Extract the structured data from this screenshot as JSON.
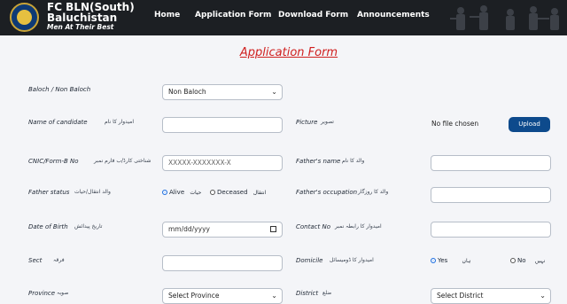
{
  "header": {
    "brand_line1": "FC BLN(South)",
    "brand_line2": "Baluchistan",
    "brand_tagline": "Men At Their Best",
    "nav": [
      "Home",
      "Application Form",
      "Download Form",
      "Announcements"
    ],
    "bg_color": "#1c1f23"
  },
  "form": {
    "title": "Application Form",
    "baloch": {
      "label": "Baloch / Non Baloch",
      "value": "Non Baloch"
    },
    "name": {
      "label": "Name of candidate",
      "urdu": "امیدوار کا نام"
    },
    "picture": {
      "label": "Picture",
      "urdu": "تصویر",
      "file_status": "No file chosen",
      "button": "Upload"
    },
    "cnic": {
      "label": "CNIC/Form-B No",
      "urdu": "شناختی کارڈ/ب فارم نمبر",
      "placeholder": "XXXXX-XXXXXXX-X"
    },
    "father_name": {
      "label": "Father's name",
      "urdu": "والد کا نام"
    },
    "father_status": {
      "label": "Father status",
      "urdu": "والد انتقال/حیات",
      "alive": "Alive",
      "alive_urdu": "حیات",
      "deceased": "Deceased",
      "deceased_urdu": "انتقال",
      "selected": "Alive"
    },
    "father_occupation": {
      "label": "Father's occupation",
      "urdu": "والد کا روزگار"
    },
    "dob": {
      "label": "Date of Birth",
      "urdu": "تاریخ پیدائش",
      "placeholder": "mm/dd/yyyy"
    },
    "contact": {
      "label": "Contact No",
      "urdu": "امیدوار کا رابطہ نمبر"
    },
    "sect": {
      "label": "Sect",
      "urdu": "فرقہ"
    },
    "domicile": {
      "label": "Domicile",
      "urdu": "امیدوار کا ڈومیسائل",
      "yes": "Yes",
      "yes_urdu": "ہاں",
      "no": "No",
      "no_urdu": "نہیں",
      "selected": "Yes"
    },
    "province": {
      "label": "Province",
      "urdu": "صوبہ",
      "value": "Select Province"
    },
    "district": {
      "label": "District",
      "urdu": "ضلع",
      "value": "Select District"
    }
  },
  "colors": {
    "title": "#d0201f",
    "upload_button": "#0d4a8c",
    "radio_selected": "#1f6fe0"
  }
}
